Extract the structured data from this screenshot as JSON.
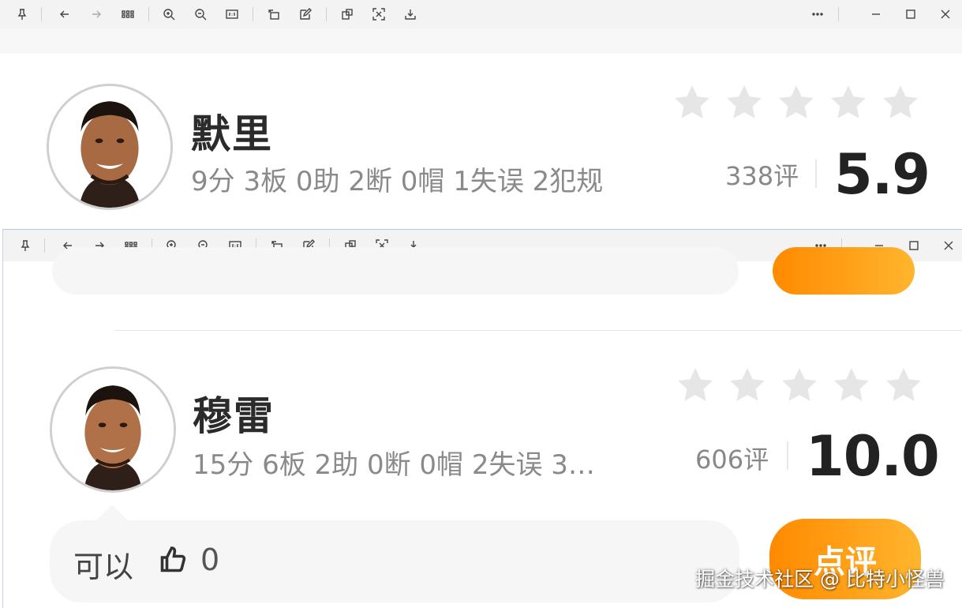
{
  "windows": [
    {
      "player": {
        "name": "默里",
        "stats": "9分 3板 0助 2断 0帽 1失误 2犯规",
        "reviews": "338评",
        "score": "5.9",
        "stars": [
          "star",
          "star",
          "star",
          "star",
          "star"
        ]
      }
    },
    {
      "player": {
        "name": "穆雷",
        "stats": "15分 6板 2助 0断 0帽 2失误 3…",
        "reviews": "606评",
        "score": "10.0",
        "stars": [
          "star",
          "star",
          "star",
          "star",
          "star"
        ]
      },
      "comment": {
        "text": "可以",
        "likes": "0"
      },
      "review_button": "点评"
    }
  ],
  "toolbar_icons": [
    "pin-icon",
    "back-icon",
    "forward-icon",
    "grid-icon",
    "zoom-in-icon",
    "zoom-out-icon",
    "actual-size-icon",
    "rotate-icon",
    "edit-icon",
    "ocr-icon",
    "scan-icon",
    "save-icon",
    "more-icon",
    "minimize-icon",
    "maximize-icon",
    "close-icon"
  ],
  "colors": {
    "accent_orange": "#ff8a00",
    "star_gray": "#e6e6e6"
  },
  "watermark": "掘金技术社区 @ 比特小怪兽"
}
